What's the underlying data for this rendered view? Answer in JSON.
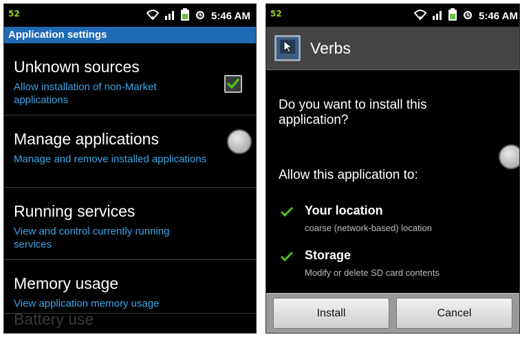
{
  "status_bar": {
    "left_indicator": "52",
    "time": "5:46 AM"
  },
  "settings_screen": {
    "section_title": "Application settings",
    "items": [
      {
        "title": "Unknown sources",
        "subtitle": "Allow installation of non-Market applications",
        "control": "checkbox",
        "checked": true
      },
      {
        "title": "Manage applications",
        "subtitle": "Manage and remove installed applications",
        "control": "none"
      },
      {
        "title": "Running services",
        "subtitle": "View and control currently running services",
        "control": "none"
      },
      {
        "title": "Memory usage",
        "subtitle": "View application memory usage",
        "control": "none"
      }
    ],
    "partial_item": "Battery use"
  },
  "install_screen": {
    "app_name": "Verbs",
    "prompt": "Do you want to install this application?",
    "allow_label": "Allow this application to:",
    "permissions": [
      {
        "title": "Your location",
        "description": "coarse (network-based) location"
      },
      {
        "title": "Storage",
        "description": "Modify or delete SD card contents"
      }
    ],
    "install_button": "Install",
    "cancel_button": "Cancel"
  },
  "colors": {
    "accent_blue": "#1e6ab4",
    "subtitle_blue": "#3aa5e6",
    "check_green": "#4ec01f"
  }
}
